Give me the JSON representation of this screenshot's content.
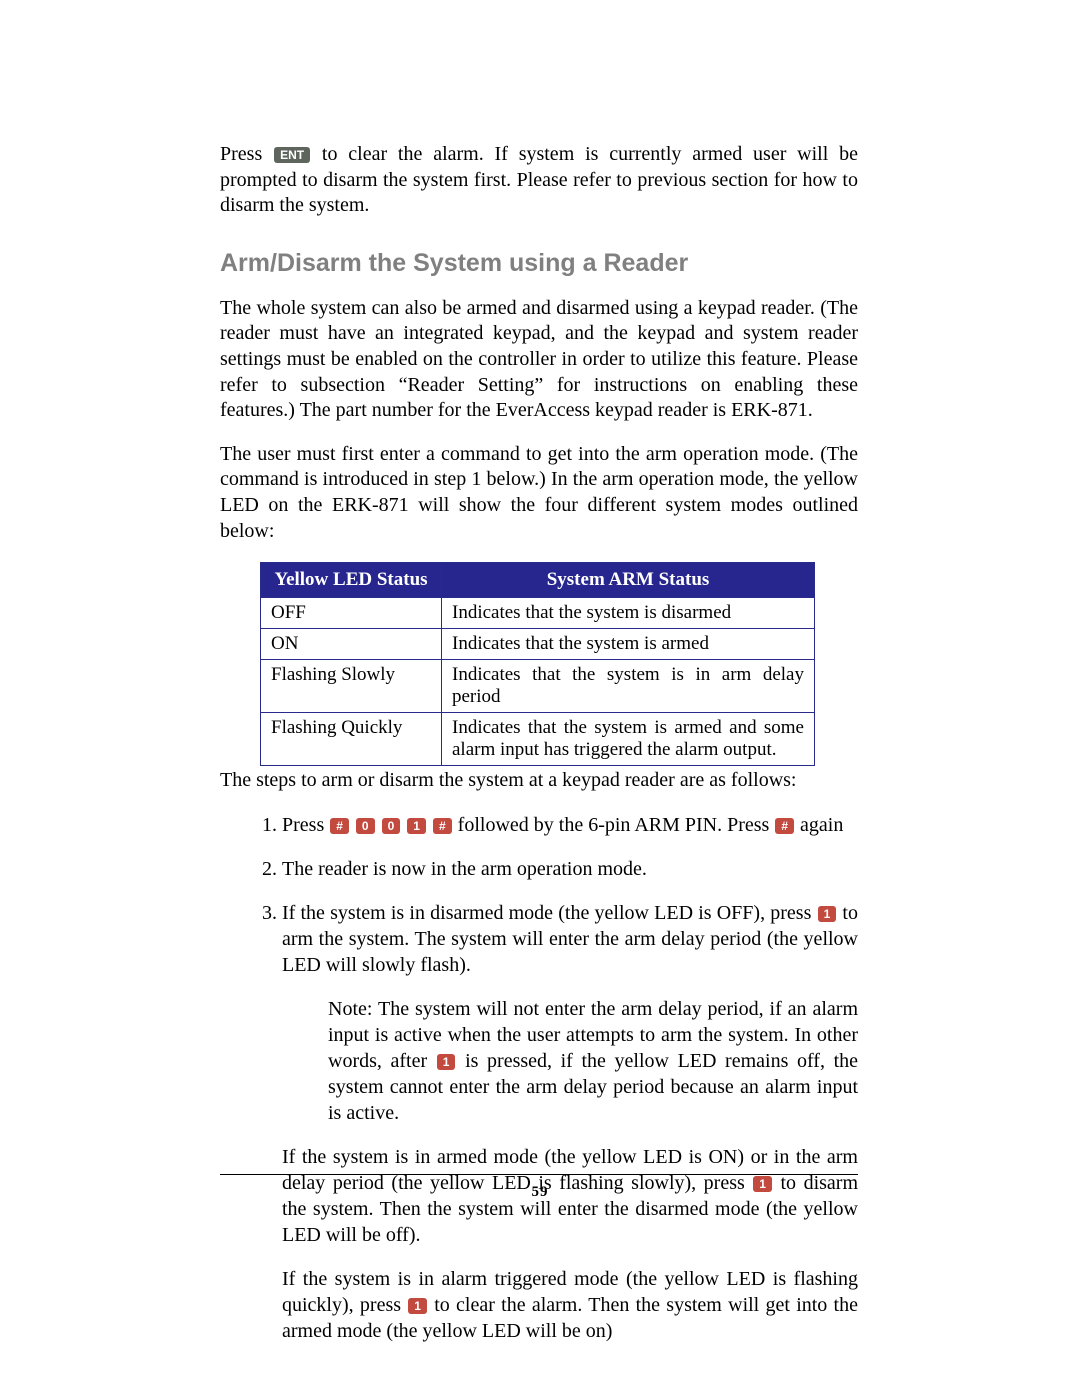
{
  "page_number": "59",
  "keys": {
    "ent": "ENT",
    "hash": "#",
    "zero": "0",
    "one": "1"
  },
  "intro": {
    "p1_pre": "Press ",
    "p1_post": " to clear the alarm. If system is currently armed user will be prompted to disarm the system first. Please refer to previous section for how to disarm the system."
  },
  "heading": "Arm/Disarm the System using a Reader",
  "body": {
    "p1": "The whole system can also be armed and disarmed using a keypad reader.  (The reader must have an integrated keypad, and the keypad and system reader settings must be enabled on the controller in order to utilize this feature. Please refer to subsection “Reader Setting” for instructions on enabling these features.) The part number for the EverAccess keypad reader is ERK-871.",
    "p2": "The user must first enter a command to get into the arm operation mode. (The command is introduced in step 1 below.) In the arm operation mode, the yellow LED on the ERK-871 will show the four different system modes outlined below:"
  },
  "table": {
    "header_yellow": "Yellow LED Status",
    "header_system": "System ARM Status",
    "rows": [
      {
        "led": "OFF",
        "desc": "Indicates that the system is disarmed"
      },
      {
        "led": "ON",
        "desc": "Indicates that the system is armed"
      },
      {
        "led": "Flashing Slowly",
        "desc": "Indicates that the system is in arm delay period"
      },
      {
        "led": "Flashing Quickly",
        "desc": "Indicates that the system is armed and some alarm input has triggered the alarm output."
      }
    ]
  },
  "after_table": "The steps to arm or disarm the system at a keypad reader are as follows:",
  "steps": {
    "s1_pre": "Press ",
    "s1_mid": " followed by the 6-pin ARM PIN.  Press ",
    "s1_post": " again",
    "s2": "The reader is now in the arm operation mode.",
    "s3_pre": "If the system is in disarmed mode (the yellow LED is OFF), press ",
    "s3_post": " to arm the system. The system will enter the arm delay period (the yellow LED will slowly flash).",
    "s3_note_pre": "Note: The system will not enter the arm delay period, if an alarm input is active when the user attempts to arm the system. In other words, after ",
    "s3_note_post": " is pressed, if the yellow LED remains off, the system cannot enter the arm delay period because an alarm input is active.",
    "s3_para2_pre": "If the system is in armed mode (the yellow LED is ON) or in the arm delay period (the yellow LED is flashing slowly), press ",
    "s3_para2_post": " to disarm the system. Then the system will enter the disarmed mode (the yellow LED will be off).",
    "s3_para3_pre": "If the system is in alarm triggered mode (the yellow LED is flashing quickly), press ",
    "s3_para3_post": " to clear the alarm. Then the system will get into the armed mode (the yellow LED will be on)"
  }
}
